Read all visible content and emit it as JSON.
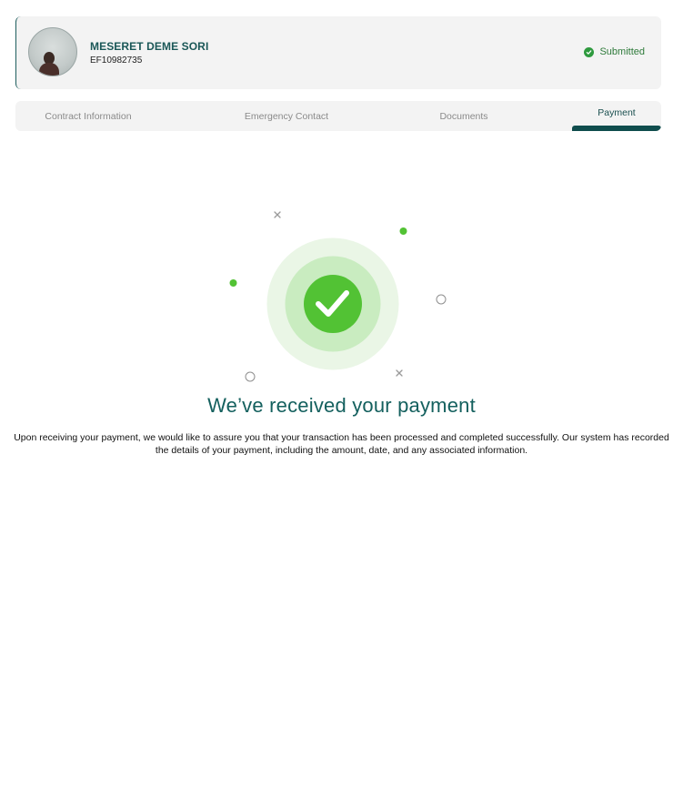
{
  "profile": {
    "name": "MESERET DEME SORI",
    "id": "EF10982735",
    "status": "Submitted"
  },
  "tabs": [
    {
      "label": "Contract Information",
      "active": false
    },
    {
      "label": "Emergency Contact",
      "active": false
    },
    {
      "label": "Documents",
      "active": false
    },
    {
      "label": "Payment",
      "active": true
    }
  ],
  "confirmation": {
    "headline": "We’ve received your payment",
    "message": "Upon receiving your payment, we would like to assure you that your transaction has been processed and completed successfully. Our system has recorded the details of your payment, including the amount, date, and any associated information."
  },
  "colors": {
    "brand": "#0f4d4d",
    "success": "#52c234",
    "status_text": "#2e7a3a"
  },
  "icons": {
    "status": "check-circle-icon",
    "success": "checkmark-icon"
  }
}
